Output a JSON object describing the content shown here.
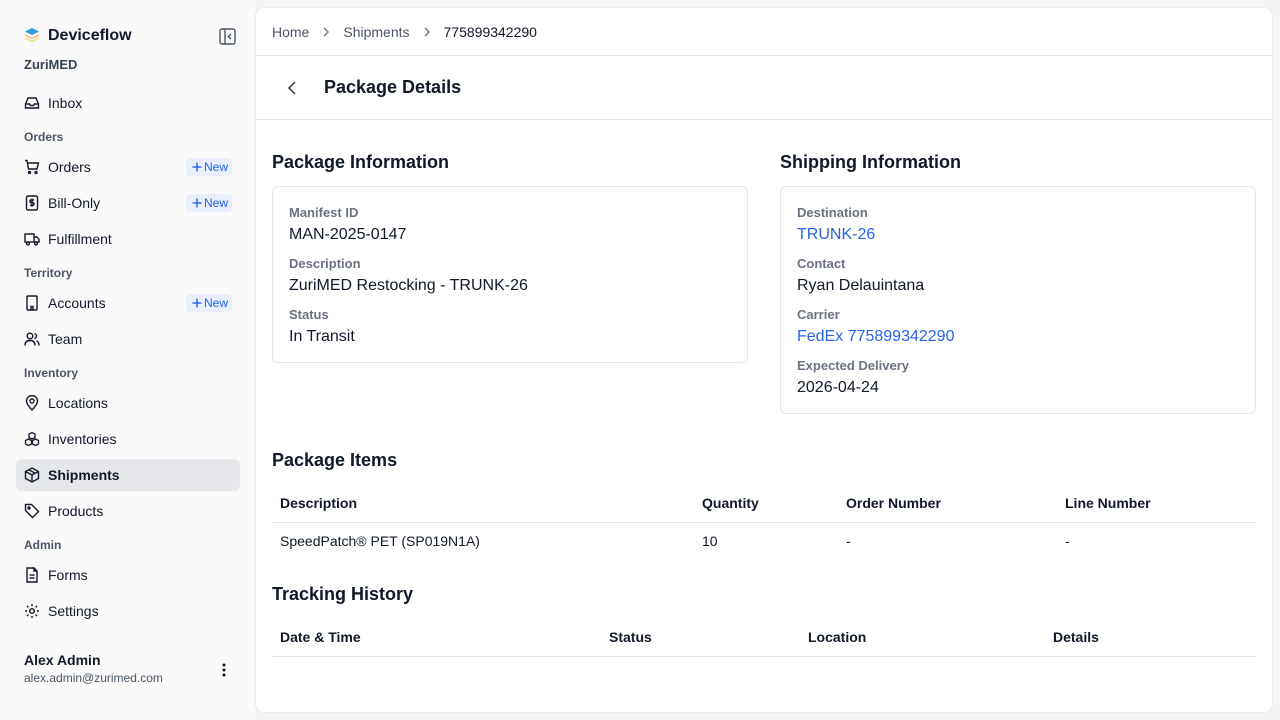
{
  "app": {
    "name": "Deviceflow",
    "org": "ZuriMED"
  },
  "colors": {
    "accent": "#2563eb",
    "active_bg": "#e5e7eb",
    "badge_bg": "#e8eefb"
  },
  "sidebar": {
    "items": [
      {
        "type": "item",
        "label": "Inbox",
        "icon": "inbox-icon"
      },
      {
        "type": "section",
        "label": "Orders"
      },
      {
        "type": "item",
        "label": "Orders",
        "icon": "cart-icon",
        "badge": "New"
      },
      {
        "type": "item",
        "label": "Bill-Only",
        "icon": "receipt-icon",
        "badge": "New"
      },
      {
        "type": "item",
        "label": "Fulfillment",
        "icon": "truck-icon"
      },
      {
        "type": "section",
        "label": "Territory"
      },
      {
        "type": "item",
        "label": "Accounts",
        "icon": "building-icon",
        "badge": "New"
      },
      {
        "type": "item",
        "label": "Team",
        "icon": "users-icon"
      },
      {
        "type": "section",
        "label": "Inventory"
      },
      {
        "type": "item",
        "label": "Locations",
        "icon": "map-pin-icon"
      },
      {
        "type": "item",
        "label": "Inventories",
        "icon": "boxes-icon"
      },
      {
        "type": "item",
        "label": "Shipments",
        "icon": "package-icon",
        "active": true
      },
      {
        "type": "item",
        "label": "Products",
        "icon": "tag-icon"
      },
      {
        "type": "section",
        "label": "Admin"
      },
      {
        "type": "item",
        "label": "Forms",
        "icon": "file-icon"
      },
      {
        "type": "item",
        "label": "Settings",
        "icon": "gear-icon"
      }
    ]
  },
  "user": {
    "name": "Alex Admin",
    "email": "alex.admin@zurimed.com"
  },
  "breadcrumb": {
    "home": "Home",
    "shipments": "Shipments",
    "current": "775899342290"
  },
  "page": {
    "title": "Package Details"
  },
  "package_info": {
    "title": "Package Information",
    "manifest_label": "Manifest ID",
    "manifest_value": "MAN-2025-0147",
    "description_label": "Description",
    "description_value": "ZuriMED Restocking - TRUNK-26",
    "status_label": "Status",
    "status_value": "In Transit"
  },
  "shipping_info": {
    "title": "Shipping Information",
    "destination_label": "Destination",
    "destination_value": "TRUNK-26",
    "contact_label": "Contact",
    "contact_value": "Ryan Delauintana",
    "carrier_label": "Carrier",
    "carrier_value": "FedEx 775899342290",
    "delivery_label": "Expected Delivery",
    "delivery_value": "2026-04-24"
  },
  "package_items": {
    "title": "Package Items",
    "columns": [
      "Description",
      "Quantity",
      "Order Number",
      "Line Number"
    ],
    "rows": [
      [
        "SpeedPatch® PET (SP019N1A)",
        "10",
        "-",
        "-"
      ]
    ]
  },
  "tracking": {
    "title": "Tracking History",
    "columns": [
      "Date & Time",
      "Status",
      "Location",
      "Details"
    ]
  }
}
